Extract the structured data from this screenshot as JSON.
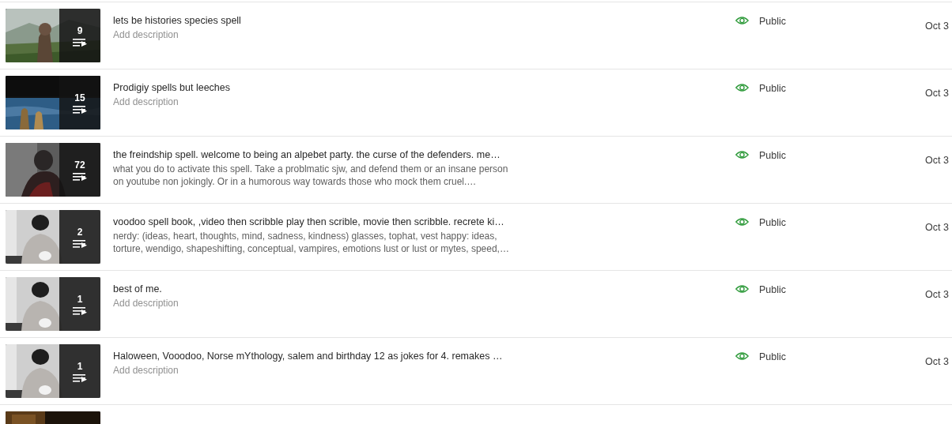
{
  "playlists": [
    {
      "title": "lets be histories species spell",
      "description": {
        "kind": "placeholder",
        "text": "Add description"
      },
      "count": "9",
      "thumbnail": {
        "kind": "picture"
      },
      "visibility": "Public",
      "date": "Oct 3"
    },
    {
      "title": "Prodigiy spells but leeches",
      "description": {
        "kind": "placeholder",
        "text": "Add description"
      },
      "count": "15",
      "thumbnail": {
        "kind": "picture"
      },
      "visibility": "Public",
      "date": "Oct 3"
    },
    {
      "title": "the freindship spell. welcome to being an alpebet party. the curse of the defenders. me…",
      "description": {
        "kind": "text",
        "text": "what you do to activate this spell. Take a problmatic sjw, and defend them or an insane person on youtube non jokingly. Or in a humorous way towards those who mock them cruel.…"
      },
      "count": "72",
      "thumbnail": {
        "kind": "picture"
      },
      "visibility": "Public",
      "date": "Oct 3"
    },
    {
      "title": "voodoo spell book, ,video then scribble play then scrible, movie then scribble. recrete ki…",
      "description": {
        "kind": "text",
        "text": "nerdy: (ideas, heart, thoughts, mind, sadness, kindness) glasses, tophat, vest happy: ideas, torture, wendigo, shapeshifting, conceptual, vampires, emotions lust or lust or mytes, speed,…"
      },
      "count": "2",
      "thumbnail": {
        "kind": "picture"
      },
      "visibility": "Public",
      "date": "Oct 3"
    },
    {
      "title": "best of me.",
      "description": {
        "kind": "placeholder",
        "text": "Add description"
      },
      "count": "1",
      "thumbnail": {
        "kind": "picture"
      },
      "visibility": "Public",
      "date": "Oct 3"
    },
    {
      "title": "Haloween, Vooodoo, Norse mYthology, salem and birthday 12 as jokes for 4. remakes …",
      "description": {
        "kind": "placeholder",
        "text": "Add description"
      },
      "count": "1",
      "thumbnail": {
        "kind": "picture"
      },
      "visibility": "Public",
      "date": "Oct 3"
    },
    {
      "thumbnail": {
        "kind": "picture"
      }
    }
  ]
}
